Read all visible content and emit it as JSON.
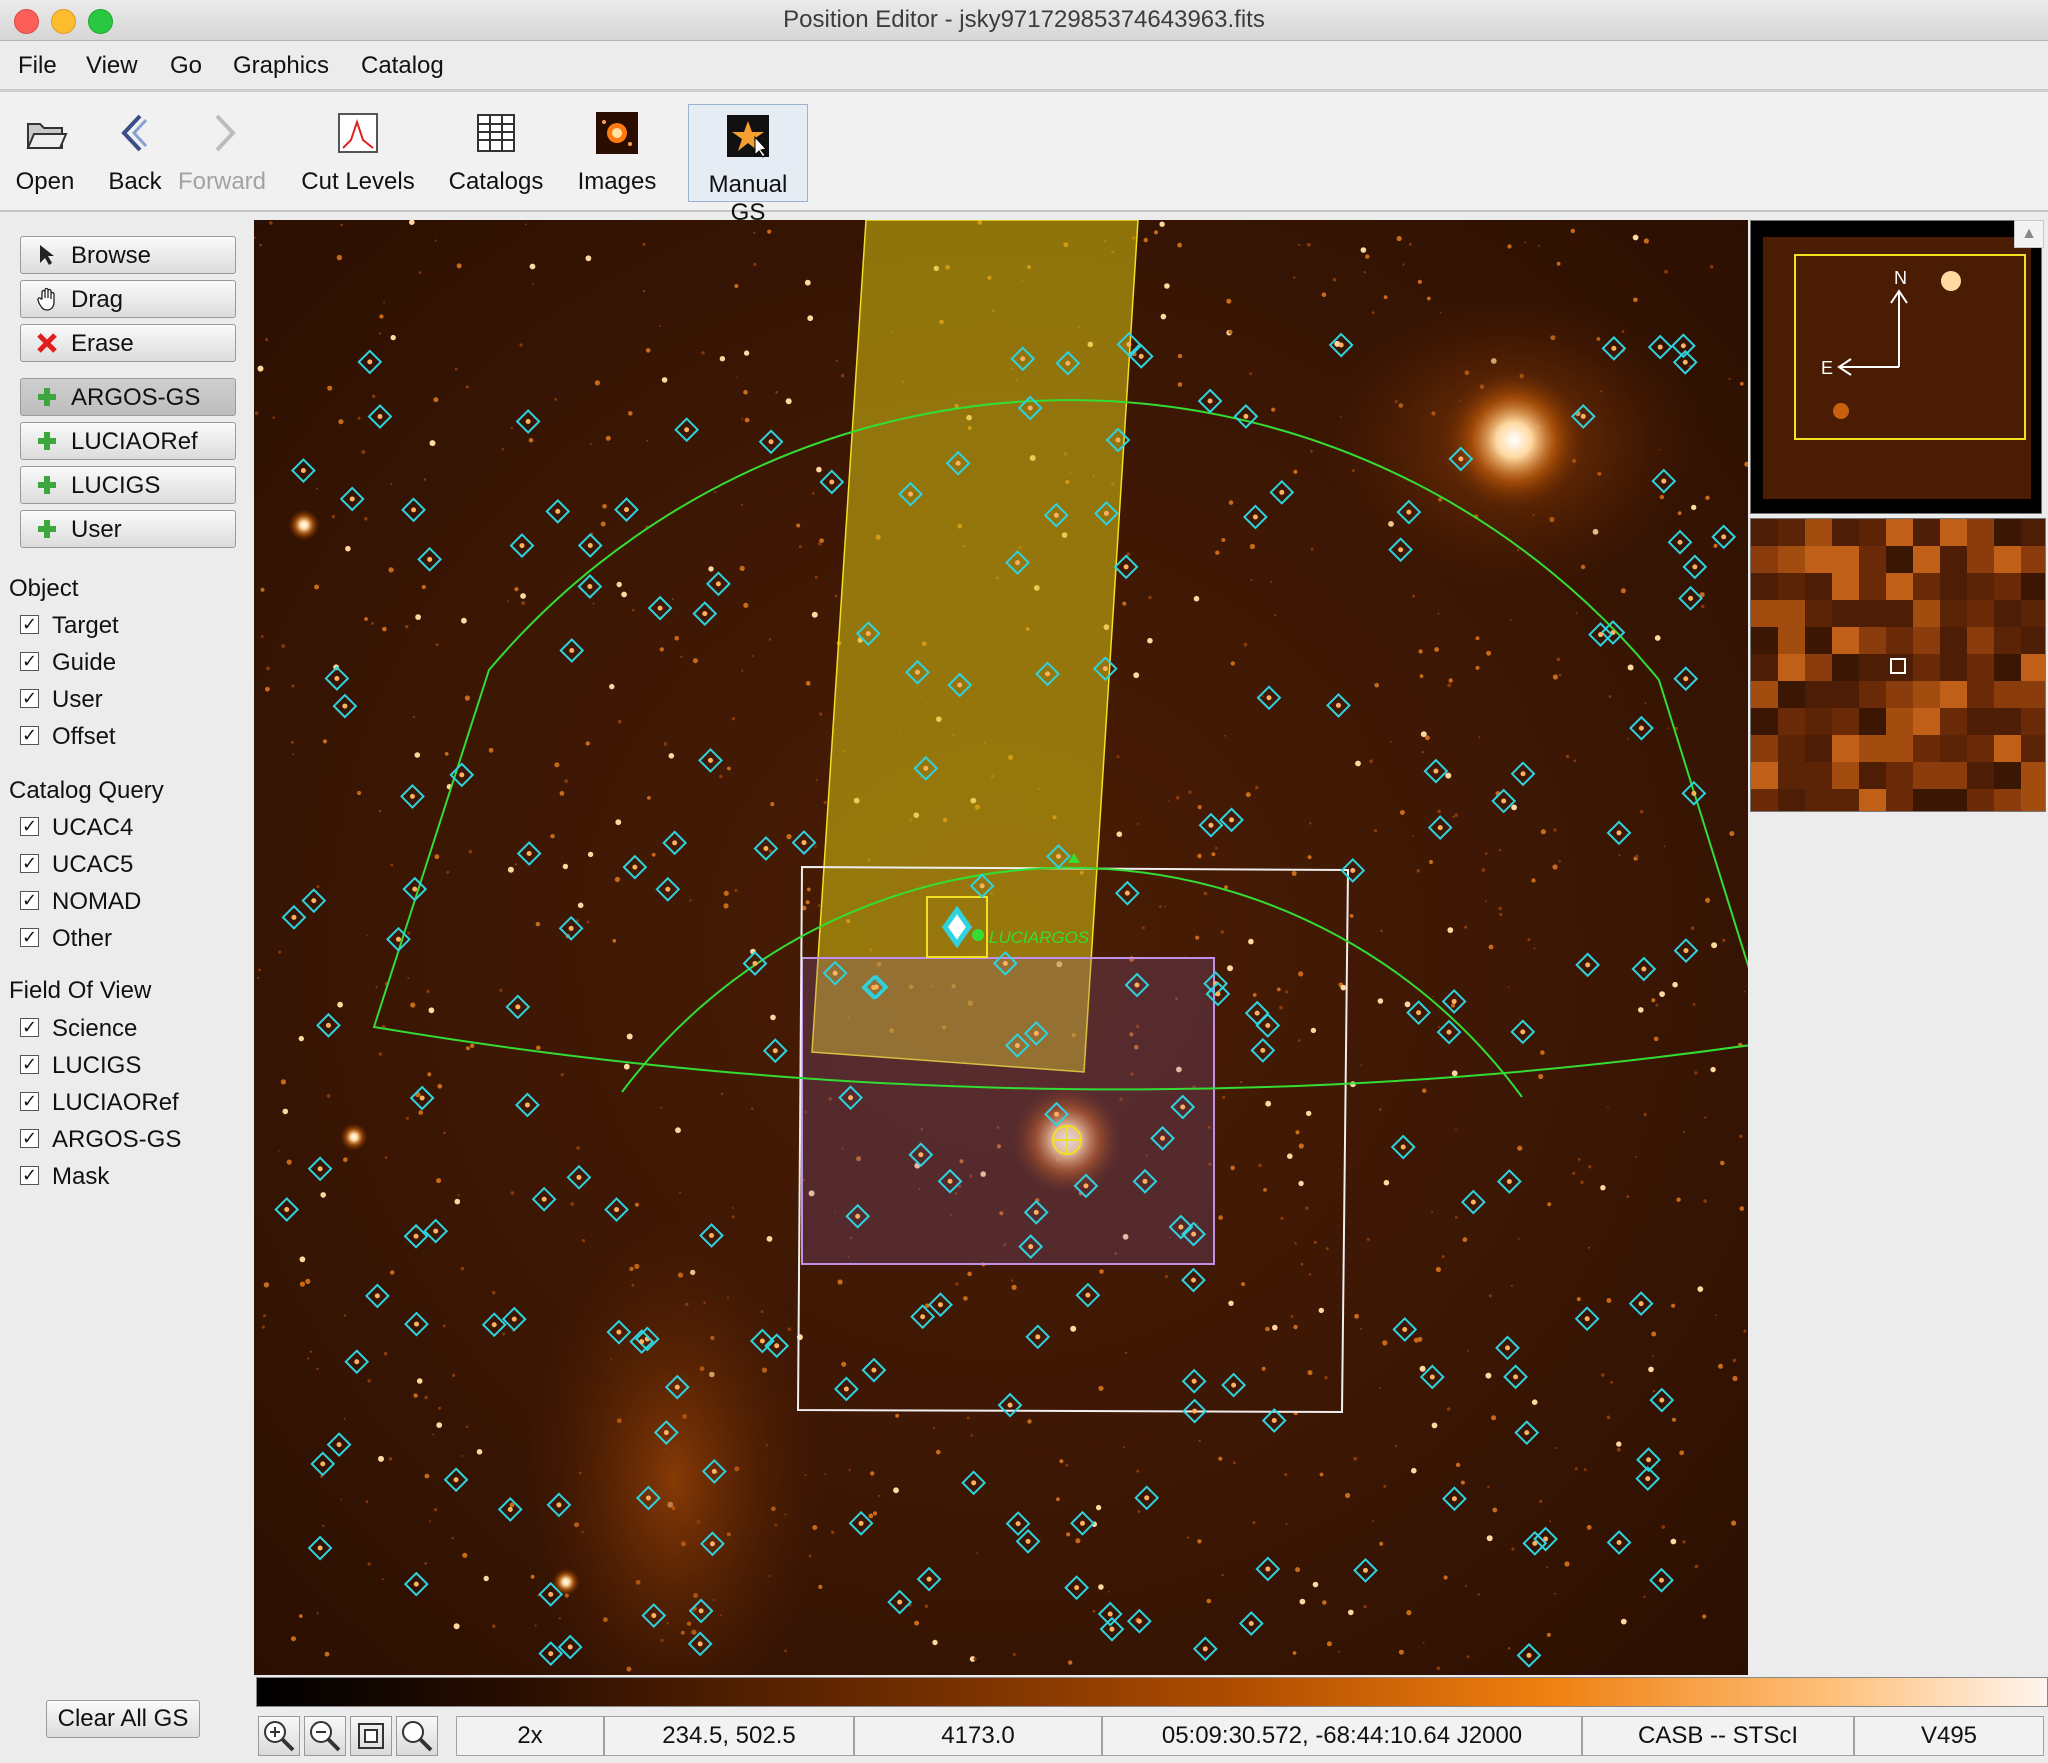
{
  "window": {
    "title": "Position Editor - jsky97172985374643963.fits"
  },
  "menu": {
    "items": [
      "File",
      "View",
      "Go",
      "Graphics",
      "Catalog"
    ]
  },
  "toolbar": {
    "open": "Open",
    "back": "Back",
    "forward": "Forward",
    "cut_levels": "Cut Levels",
    "catalogs": "Catalogs",
    "images": "Images",
    "manual_gs": "Manual GS"
  },
  "tools": {
    "browse": "Browse",
    "drag": "Drag",
    "erase": "Erase",
    "argos_gs": "ARGOS-GS",
    "luciaoref": "LUCIAORef",
    "lucigs": "LUCIGS",
    "user": "User"
  },
  "object": {
    "title": "Object",
    "items": [
      {
        "label": "Target",
        "checked": true
      },
      {
        "label": "Guide",
        "checked": true
      },
      {
        "label": "User",
        "checked": true
      },
      {
        "label": "Offset",
        "checked": true
      }
    ]
  },
  "catalog_query": {
    "title": "Catalog Query",
    "items": [
      {
        "label": "UCAC4",
        "checked": true
      },
      {
        "label": "UCAC5",
        "checked": true
      },
      {
        "label": "NOMAD",
        "checked": true
      },
      {
        "label": "Other",
        "checked": true
      }
    ]
  },
  "field_of_view": {
    "title": "Field Of View",
    "items": [
      {
        "label": "Science",
        "checked": true
      },
      {
        "label": "LUCIGS",
        "checked": true
      },
      {
        "label": "LUCIAORef",
        "checked": true
      },
      {
        "label": "ARGOS-GS",
        "checked": true
      },
      {
        "label": "Mask",
        "checked": true
      }
    ]
  },
  "clear_all_gs": "Clear All GS",
  "viewer": {
    "target_label": "LUCIARGOS"
  },
  "panner": {
    "north": "N",
    "east": "E"
  },
  "status": {
    "zoom": "2x",
    "pixel": "234.5, 502.5",
    "value": "4173.0",
    "coords": "05:09:30.572, -68:44:10.64 J2000",
    "survey": "CASB -- STScI",
    "band": "V495"
  },
  "colors": {
    "accent_cyan": "#2fd3df",
    "fov_green": "#33dd33",
    "science_yellow": "#e8d21a",
    "mask_purple": "#b07ad8",
    "image_orange": "#c85a00"
  }
}
